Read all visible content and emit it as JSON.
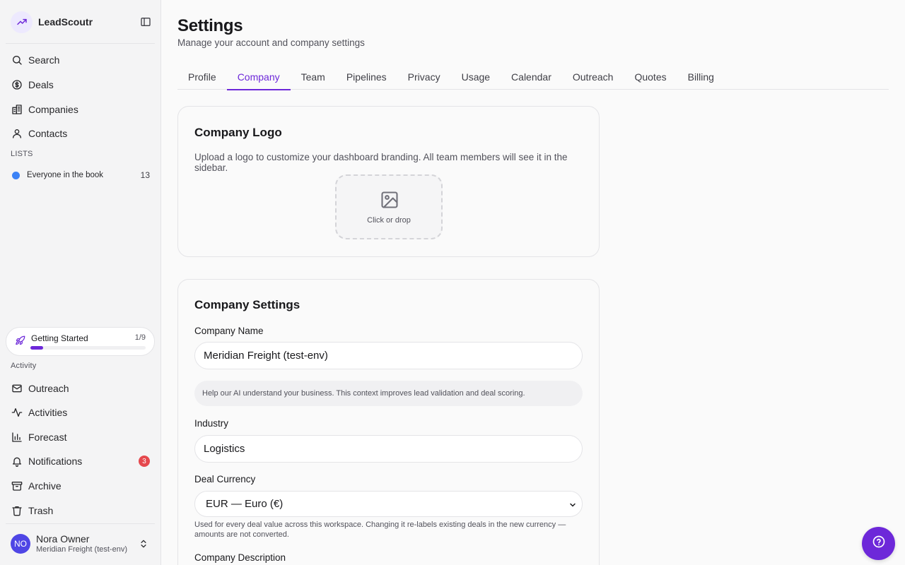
{
  "brand": {
    "name": "LeadScoutr"
  },
  "sidebar": {
    "nav": [
      {
        "label": "Search",
        "icon": "search-icon"
      },
      {
        "label": "Deals",
        "icon": "dollar-circle-icon"
      },
      {
        "label": "Companies",
        "icon": "building-icon"
      },
      {
        "label": "Contacts",
        "icon": "user-icon"
      }
    ],
    "lists_label": "LISTS",
    "lists": [
      {
        "label": "Everyone in the book",
        "count": "13",
        "color": "#3b82f6"
      }
    ],
    "getting_started": {
      "label": "Getting Started",
      "count": "1/9",
      "progress": 0.11
    },
    "activity_label": "Activity",
    "activity": [
      {
        "label": "Outreach",
        "icon": "mail-icon"
      },
      {
        "label": "Activities",
        "icon": "activity-icon"
      },
      {
        "label": "Forecast",
        "icon": "bar-chart-icon"
      },
      {
        "label": "Notifications",
        "icon": "bell-icon",
        "badge": "3"
      },
      {
        "label": "Archive",
        "icon": "archive-icon"
      },
      {
        "label": "Trash",
        "icon": "trash-icon"
      }
    ],
    "user": {
      "initials": "NO",
      "name": "Nora Owner",
      "org": "Meridian Freight (test-env)"
    }
  },
  "page": {
    "title": "Settings",
    "subtitle": "Manage your account and company settings",
    "tabs": [
      "Profile",
      "Company",
      "Team",
      "Pipelines",
      "Privacy",
      "Usage",
      "Calendar",
      "Outreach",
      "Quotes",
      "Billing"
    ],
    "active_tab": "Company"
  },
  "logo_card": {
    "title": "Company Logo",
    "description": "Upload a logo to customize your dashboard branding. All team members will see it in the sidebar.",
    "dropzone_text": "Click or drop"
  },
  "settings_card": {
    "title": "Company Settings",
    "company_name_label": "Company Name",
    "company_name_value": "Meridian Freight (test-env)",
    "ai_hint": "Help our AI understand your business. This context improves lead validation and deal scoring.",
    "industry_label": "Industry",
    "industry_value": "Logistics",
    "currency_label": "Deal Currency",
    "currency_value": "EUR — Euro (€)",
    "currency_help": "Used for every deal value across this workspace. Changing it re-labels existing deals in the new currency — amounts are not converted.",
    "description_label": "Company Description"
  },
  "colors": {
    "accent": "#6d28d9",
    "badge": "#e5484d",
    "list_dot": "#3b82f6"
  }
}
